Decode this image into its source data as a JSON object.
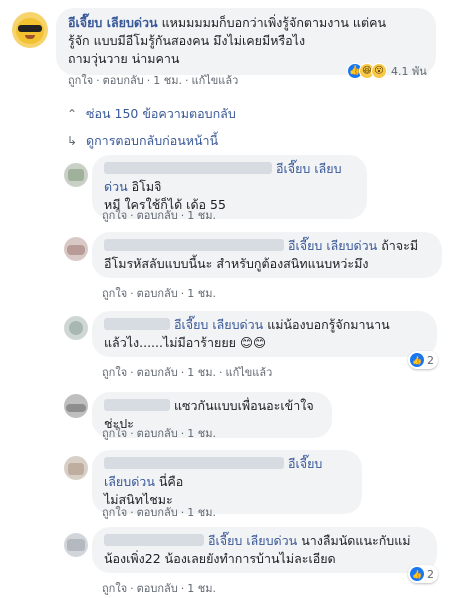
{
  "main_comment": {
    "author": "อีเจี๊ยบ เลียบด่วน",
    "line1": " แหมมมมมก็บอกว่าเพิ่งรู้จักตามงาน แต่คน",
    "line2": "รู้จัก แบบมีอีโมรู้กันสองคน มึงไม่เคยมีหรือไง",
    "line3": "ถามวุ่นวาย น่ามคาน",
    "like": "ถูกใจ",
    "reply": "ตอบกลับ",
    "time": "1 ชม.",
    "edited": "แก้ไขแล้ว",
    "reaction_count": "4.1 พัน",
    "reaction_icons": [
      "like-icon",
      "haha-icon",
      "wow-icon"
    ]
  },
  "hide_replies": "ซ่อน 150 ข้อความตอบกลับ",
  "previous_replies": "ดูการตอบกลับก่อนหน้านี้",
  "replies": [
    {
      "tag": "อีเจี๊ยบ เลียบด่วน",
      "text1": " อิโมจิ",
      "text2": "หมี ใครใช้ก็ได้ เด้อ 55",
      "like": "ถูกใจ",
      "reply": "ตอบกลับ",
      "time": "1 ชม."
    },
    {
      "tag": "อีเจี๊ยบ เลียบด่วน",
      "text1": " ถ้าจะมี",
      "text2": "อีโมรหัสลับแบบนี้นะ สำหรับกูต้องสนิทแนบหว่ะมึง",
      "like": "ถูกใจ",
      "reply": "ตอบกลับ",
      "time": "1 ชม."
    },
    {
      "tag": "อีเจี๊ยบ เลียบด่วน",
      "text1": " แม่น้องบอกรู้จักมานาน",
      "text2": "แล้วไง......ไม่มีอาร้ายยย 😊😊",
      "like": "ถูกใจ",
      "reply": "ตอบกลับ",
      "time": "1 ชม.",
      "edited": "แก้ไขแล้ว",
      "likes": "2"
    },
    {
      "tag": "",
      "text1": "แซวกันแบบเพื่อนอะเข้าใจช่ะปะ",
      "text2": "",
      "like": "ถูกใจ",
      "reply": "ตอบกลับ",
      "time": "1 ชม."
    },
    {
      "tag": "อีเจี๊ยบ เลียบด่วน",
      "text1": " นี่คือ",
      "text2": "ไม่สนิทไชมะ",
      "like": "ถูกใจ",
      "reply": "ตอบกลับ",
      "time": "1 ชม."
    },
    {
      "tag": "อีเจี๊ยบ เลียบด่วน",
      "text1": " นางลืมนัดแนะกับแม่",
      "text2": "น้องเพิ่ง22 น้องเลยยังทำการบ้านไม่ละเอียด",
      "like": "ถูกใจ",
      "reply": "ตอบกลับ",
      "time": "1 ชม.",
      "likes": "2"
    }
  ],
  "colors": {
    "link": "#385898",
    "bubble": "#f2f3f5",
    "meta": "#606770",
    "like_blue": "#1877f2"
  }
}
